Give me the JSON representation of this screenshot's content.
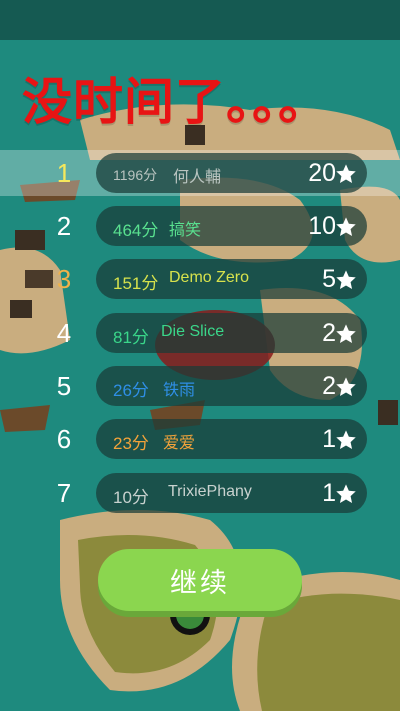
{
  "title": "没时间了。。。",
  "leaderboard": [
    {
      "rank": "1",
      "score": "1196分",
      "name": "何人輔",
      "stars": "20",
      "rank_color": "#f6e85c",
      "score_color": "#b9c4c0",
      "name_color": "#b9c4c0",
      "highlight": true
    },
    {
      "rank": "2",
      "score": "464分",
      "name": "搞笑",
      "stars": "10",
      "rank_color": "#ffffff",
      "score_color": "#59e08f",
      "name_color": "#59e08f",
      "highlight": false
    },
    {
      "rank": "3",
      "score": "151分",
      "name": "Demo Zero",
      "stars": "5",
      "rank_color": "#f0b24a",
      "score_color": "#d7e24c",
      "name_color": "#d7e24c",
      "highlight": false
    },
    {
      "rank": "4",
      "score": "81分",
      "name": "Die Slice",
      "stars": "2",
      "rank_color": "#ffffff",
      "score_color": "#3ad68a",
      "name_color": "#3ad68a",
      "highlight": false
    },
    {
      "rank": "5",
      "score": "26分",
      "name": "铁雨",
      "stars": "2",
      "rank_color": "#ffffff",
      "score_color": "#2f8fe6",
      "name_color": "#2f8fe6",
      "highlight": false
    },
    {
      "rank": "6",
      "score": "23分",
      "name": "爱爱",
      "stars": "1",
      "rank_color": "#ffffff",
      "score_color": "#f2a33a",
      "name_color": "#f2a33a",
      "highlight": false
    },
    {
      "rank": "7",
      "score": "10分",
      "name": "TrixiePhany",
      "stars": "1",
      "rank_color": "#ffffff",
      "score_color": "#c8d2cf",
      "name_color": "#c8d2cf",
      "highlight": false
    }
  ],
  "continue_label": "继续",
  "icons": {
    "star": "star-icon"
  },
  "colors": {
    "title": "#e81414",
    "button": "#8bd64f",
    "water": "#1e8a7e",
    "sand": "#c9ad7f"
  }
}
